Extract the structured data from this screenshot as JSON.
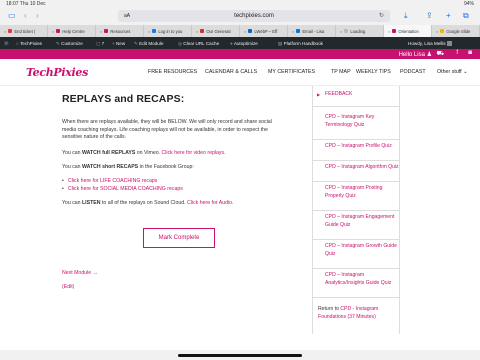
{
  "status": {
    "left": "18:07  Thu 10 Dec",
    "right": "94%"
  },
  "browser": {
    "address_aa": "aA",
    "url": "techpixies.com",
    "tabs": [
      {
        "label": "End ticket |"
      },
      {
        "label": "Help Centre"
      },
      {
        "label": "Resources"
      },
      {
        "label": "Log in to you"
      },
      {
        "label": "Our Generati"
      },
      {
        "label": "LWebP – Eff"
      },
      {
        "label": "Email - Lisa"
      },
      {
        "label": "Loading"
      },
      {
        "label": "Orientation"
      },
      {
        "label": "Google Slide"
      }
    ]
  },
  "admin_bar": {
    "site": "TechPixies",
    "customize": "Customize",
    "comments": "7",
    "new": "New",
    "edit_module": "Edit Module",
    "clear_cache": "Clear URL Cache",
    "autoptimize": "Autoptimize",
    "handbook": "Platform Handbook",
    "howdy": "Howdy, Lisa Mellis"
  },
  "header": {
    "hello": "Hello Lisa"
  },
  "site": {
    "logo": "TechPixies",
    "nav": [
      "FREE RESOURCES",
      "CALENDAR & CALLS",
      "MY CERTIFICATES",
      "TP MAP",
      "WEEKLY TIPS",
      "PODCAST",
      "Other stuff"
    ]
  },
  "content": {
    "title": "REPLAYS and RECAPS:",
    "para1": "When there are replays available, they will be BELOW. We will only record and share social media coaching replays. Life coaching replays will not be available, in order to respect the sensitive nature of the calls.",
    "vimeo_prefix": "You can",
    "vimeo_bold": "WATCH full REPLAYS",
    "vimeo_mid": "on Vimeo.",
    "vimeo_link": "Click here for video replays.",
    "recap_prefix": "You can",
    "recap_bold": "WATCH short RECAPS",
    "recap_suffix": "in the Facebook Group:",
    "recap_links": [
      "Click here for LIFE COACHING recaps",
      "Click here for SOCIAL MEDIA COACHING recaps"
    ],
    "listen_prefix": "You can",
    "listen_bold": "LISTEN",
    "listen_mid": "to all of the replays on Sound Cloud.",
    "listen_link": "Click here for Audio.",
    "mark_complete": "Mark Complete",
    "next_module": "Next Module →",
    "edit": "(Edit)"
  },
  "sidebar": {
    "items": [
      "FEEDBACK",
      "CPD – Instagram Key Terminology Quiz",
      "CPD – Instagram Profile Quiz",
      "CPD – Instagram Algorithm Quiz",
      "CPD – Instagram Posting Properly Quiz",
      "CPD – Instagram Engagement Guide Quiz",
      "CPD – Instagram Growth Guide Quiz",
      "CPD – Instagram Analytics/Insights Guide Quiz"
    ],
    "return_prefix": "Return to",
    "return_link": "CPD - Instagram Foundations (37 Minutes)"
  },
  "colors": {
    "brand": "#c8106e",
    "admin_bar": "#23282d"
  }
}
